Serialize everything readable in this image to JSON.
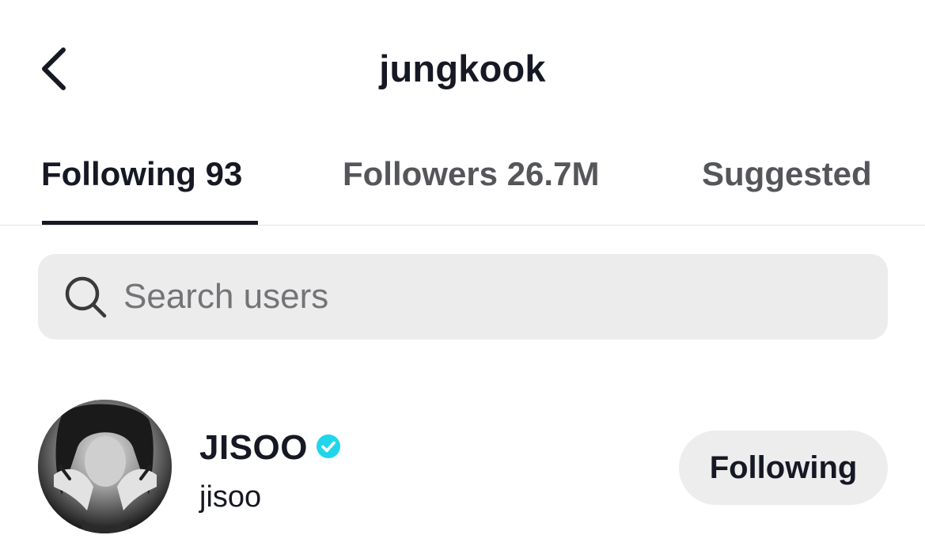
{
  "header": {
    "title": "jungkook",
    "back_icon": "chevron-left-icon"
  },
  "tabs": [
    {
      "label": "Following 93",
      "active": true
    },
    {
      "label": "Followers 26.7M",
      "active": false
    },
    {
      "label": "Suggested",
      "active": false
    }
  ],
  "search": {
    "placeholder": "Search users",
    "value": "",
    "icon": "search-icon"
  },
  "users": [
    {
      "display_name": "JISOO",
      "username": "jisoo",
      "verified": true,
      "verified_color": "#20d5ec",
      "button_label": "Following"
    }
  ],
  "colors": {
    "text_primary": "#161823",
    "text_secondary": "#555659",
    "search_bg": "#ececec",
    "button_bg": "#ededed"
  }
}
